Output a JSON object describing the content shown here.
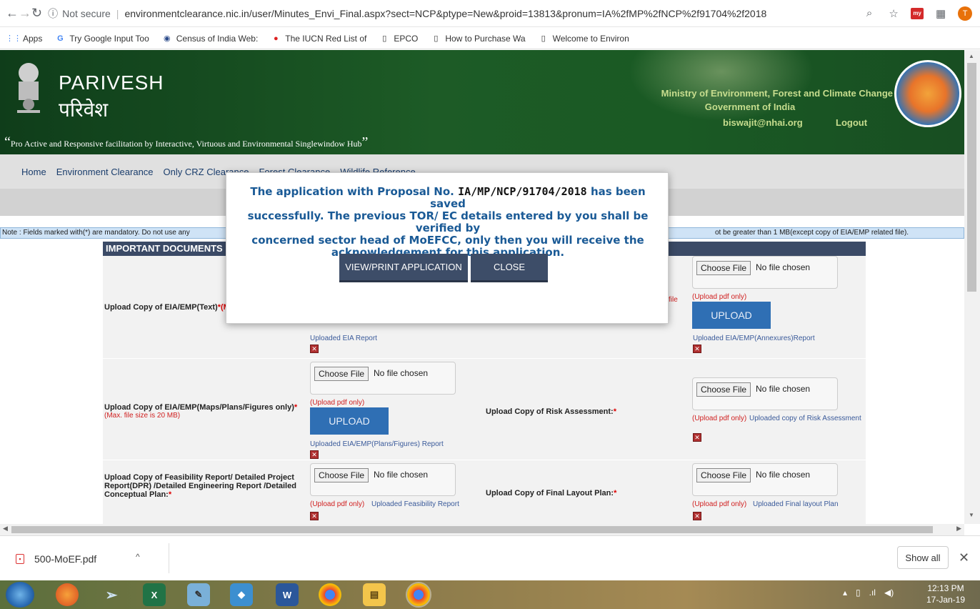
{
  "browser": {
    "security_label": "Not secure",
    "url": "environmentclearance.nic.in/user/Minutes_Envi_Final.aspx?sect=NCP&ptype=New&proid=13813&pronum=IA%2fMP%2fNCP%2f91704%2f2018",
    "profile_initial": "T",
    "ext_label": "my"
  },
  "bookmarks": [
    {
      "label": "Apps"
    },
    {
      "label": "Try Google Input Too"
    },
    {
      "label": "Census of India Web:"
    },
    {
      "label": "The IUCN Red List of"
    },
    {
      "label": "EPCO"
    },
    {
      "label": "How to Purchase Wa"
    },
    {
      "label": "Welcome to Environ"
    }
  ],
  "header": {
    "brand_en": "PARIVESH",
    "brand_hi": "परिवेश",
    "tagline": "Pro Active and Responsive facilitation by Interactive, Virtuous and Environmental Singlewindow Hub",
    "ministry": "Ministry of Environment, Forest and Climate Change",
    "government": "Government of India",
    "user_email": "biswajit@nhai.org",
    "logout_label": "Logout"
  },
  "menu": [
    "Home",
    "Environment Clearance",
    "Only CRZ Clearance",
    "Forest Clearance",
    "Wildlife Reference"
  ],
  "note": {
    "left": "Note : Fields marked with(*) are mandatory. Do not use any",
    "right": "ot be greater than 1 MB(except copy of EIA/EMP related file)."
  },
  "form": {
    "heading": "IMPORTANT DOCUMENTS",
    "choose_file": "Choose File",
    "no_file": "No file chosen",
    "pdf_only": "(Upload pdf only)",
    "upload_label": "UPLOAD",
    "rows": {
      "eia_text_label": "Upload Copy of EIA/EMP(Text)",
      "eia_text_note": "(M",
      "eia_uploaded": "Uploaded EIA Report",
      "annex_side": "file",
      "annex_uploaded": "Uploaded EIA/EMP(Annexures)Report",
      "maps_label": "Upload Copy of EIA/EMP(Maps/Plans/Figures only)",
      "maps_note": "(Max. file size is 20 MB)",
      "maps_uploaded": "Uploaded EIA/EMP(Plans/Figures) Report",
      "risk_label": "Upload Copy of Risk Assessment:",
      "risk_uploaded": "Uploaded copy of Risk Assessment",
      "feas_label_1": "Upload Copy of Feasibility Report/ Detailed Project",
      "feas_label_2": "Report(DPR) /Detailed Engineering Report /Detailed",
      "feas_label_3": "Conceptual Plan:",
      "feas_uploaded": "Uploaded Feasibility Report",
      "layout_label": "Upload Copy of Final Layout Plan:",
      "layout_uploaded": "Uploaded Final layout Plan"
    }
  },
  "modal": {
    "msg_1": "The application with Proposal No.",
    "proposal_no": "IA/MP/NCP/91704/2018",
    "msg_2": "has been saved",
    "msg_3": "successfully. The previous TOR/ EC details entered by you shall be verified by",
    "msg_4": "concerned sector head of MoEFCC, only then you will receive the",
    "msg_5": "acknowledgement for this application.",
    "view_print_label": "VIEW/PRINT APPLICATION",
    "close_label": "CLOSE"
  },
  "downloads": {
    "file_name": "500-MoEF.pdf",
    "show_all_label": "Show all"
  },
  "taskbar": {
    "time": "12:13 PM",
    "date": "17-Jan-19"
  }
}
